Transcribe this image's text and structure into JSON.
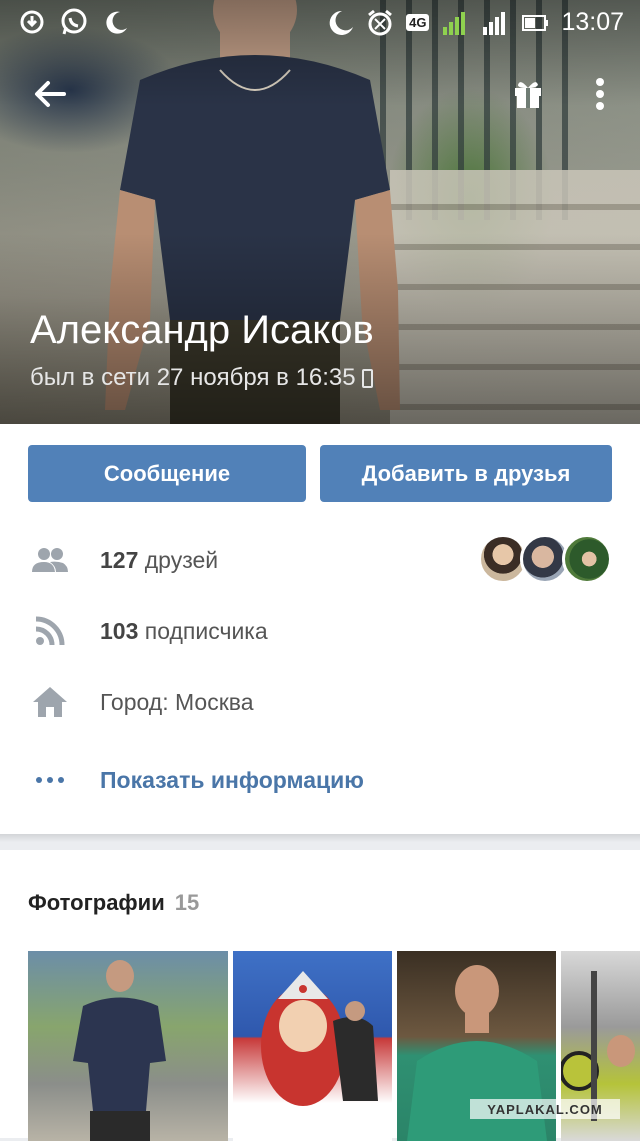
{
  "status_bar": {
    "time": "13:07",
    "network": "4G",
    "sim1": "1",
    "sim2": "2",
    "icons": [
      "download-icon",
      "whatsapp-icon",
      "moon-icon",
      "night-mode-icon",
      "alarm-icon",
      "signal-icon",
      "battery-icon"
    ]
  },
  "toolbar": {
    "back_icon": "arrow-left-icon",
    "gift_icon": "gift-icon",
    "more_icon": "more-vertical-icon"
  },
  "profile": {
    "name": "Александр Исаков",
    "last_seen": "был в сети 27 ноября в 16:35"
  },
  "actions": {
    "message_label": "Сообщение",
    "add_friend_label": "Добавить в друзья"
  },
  "info": {
    "friends_count": "127",
    "friends_label": "друзей",
    "subscribers_count": "103",
    "subscribers_label": "подписчика",
    "city": "Город: Москва",
    "show_info_label": "Показать информацию"
  },
  "photos": {
    "title": "Фотографии",
    "count": "15"
  },
  "watermark": "YAPLAKAL.COM",
  "colors": {
    "accent": "#5181b8",
    "link": "#4a76a8",
    "icon_gray": "#9ea5ad",
    "background": "#ebedf0"
  }
}
